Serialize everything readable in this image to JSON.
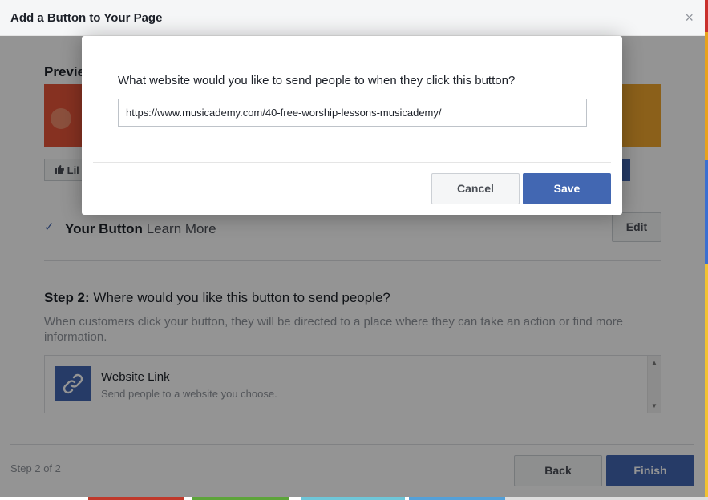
{
  "dialog": {
    "title": "Add a Button to Your Page",
    "close_glyph": "×"
  },
  "preview": {
    "title": "Previe",
    "like_label": "Lil"
  },
  "your_button": {
    "check_glyph": "✓",
    "label": "Your Button",
    "value": "Learn More",
    "edit_label": "Edit"
  },
  "step2": {
    "prefix": "Step 2:",
    "question": "Where would you like this button to send people?",
    "description": "When customers click your button, they will be directed to a place where they can take an action or find more information."
  },
  "option": {
    "icon": "link-icon",
    "title": "Website Link",
    "subtitle": "Send people to a website you choose."
  },
  "footer": {
    "step_count": "Step 2 of 2",
    "back_label": "Back",
    "finish_label": "Finish"
  },
  "modal": {
    "question": "What website would you like to send people to when they click this button?",
    "url_value": "https://www.musicademy.com/40-free-worship-lessons-musicademy/",
    "cancel_label": "Cancel",
    "save_label": "Save"
  },
  "colors": {
    "accent": "#4267b2",
    "border": "#ccd0d5",
    "muted_text": "#90949c"
  }
}
